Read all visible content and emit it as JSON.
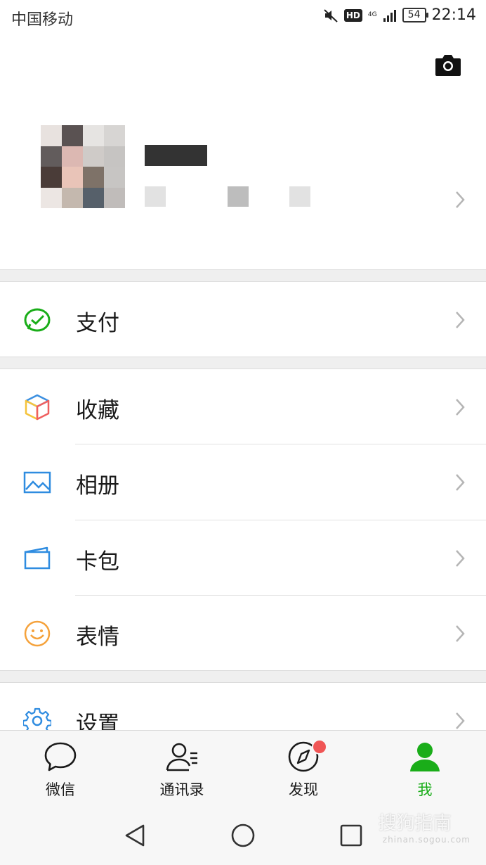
{
  "status_bar": {
    "carrier": "中国移动",
    "hd": "HD",
    "network": "4G",
    "battery": "54",
    "time": "22:14"
  },
  "profile": {
    "name_redacted": true
  },
  "menu": {
    "pay": "支付",
    "favorites": "收藏",
    "album": "相册",
    "cards": "卡包",
    "stickers": "表情",
    "settings": "设置"
  },
  "tabs": [
    {
      "label": "微信",
      "icon": "chat-bubble-icon"
    },
    {
      "label": "通讯录",
      "icon": "contacts-icon"
    },
    {
      "label": "发现",
      "icon": "compass-icon",
      "badge": true
    },
    {
      "label": "我",
      "icon": "person-icon",
      "active": true
    }
  ],
  "colors": {
    "accent_green": "#1aad19",
    "badge_red": "#f05555",
    "background_gray": "#efefef"
  },
  "watermark": {
    "brand": "搜狗指南",
    "url": "zhinan.sogou.com"
  }
}
